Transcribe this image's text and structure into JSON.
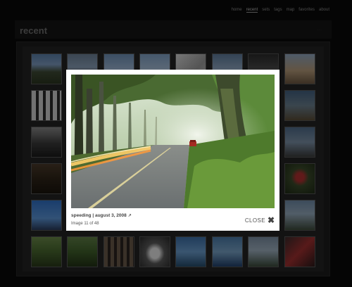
{
  "nav": {
    "items": [
      {
        "label": "home",
        "active": false
      },
      {
        "label": "recent",
        "active": true
      },
      {
        "label": "sets",
        "active": false
      },
      {
        "label": "tags",
        "active": false
      },
      {
        "label": "map",
        "active": false
      },
      {
        "label": "favorites",
        "active": false
      },
      {
        "label": "about",
        "active": false
      }
    ]
  },
  "header": {
    "title": "recent",
    "sub": "....."
  },
  "lightbox": {
    "caption": "speeding | august 3, 2008",
    "external_icon": "external-link-icon",
    "counter": "Image 11 of 48",
    "close_label": "CLOSE",
    "close_glyph": "✖"
  },
  "colors": {
    "background": "#0a0a0a",
    "panel": "#1c1c1c",
    "lightbox_bg": "#ffffff"
  }
}
